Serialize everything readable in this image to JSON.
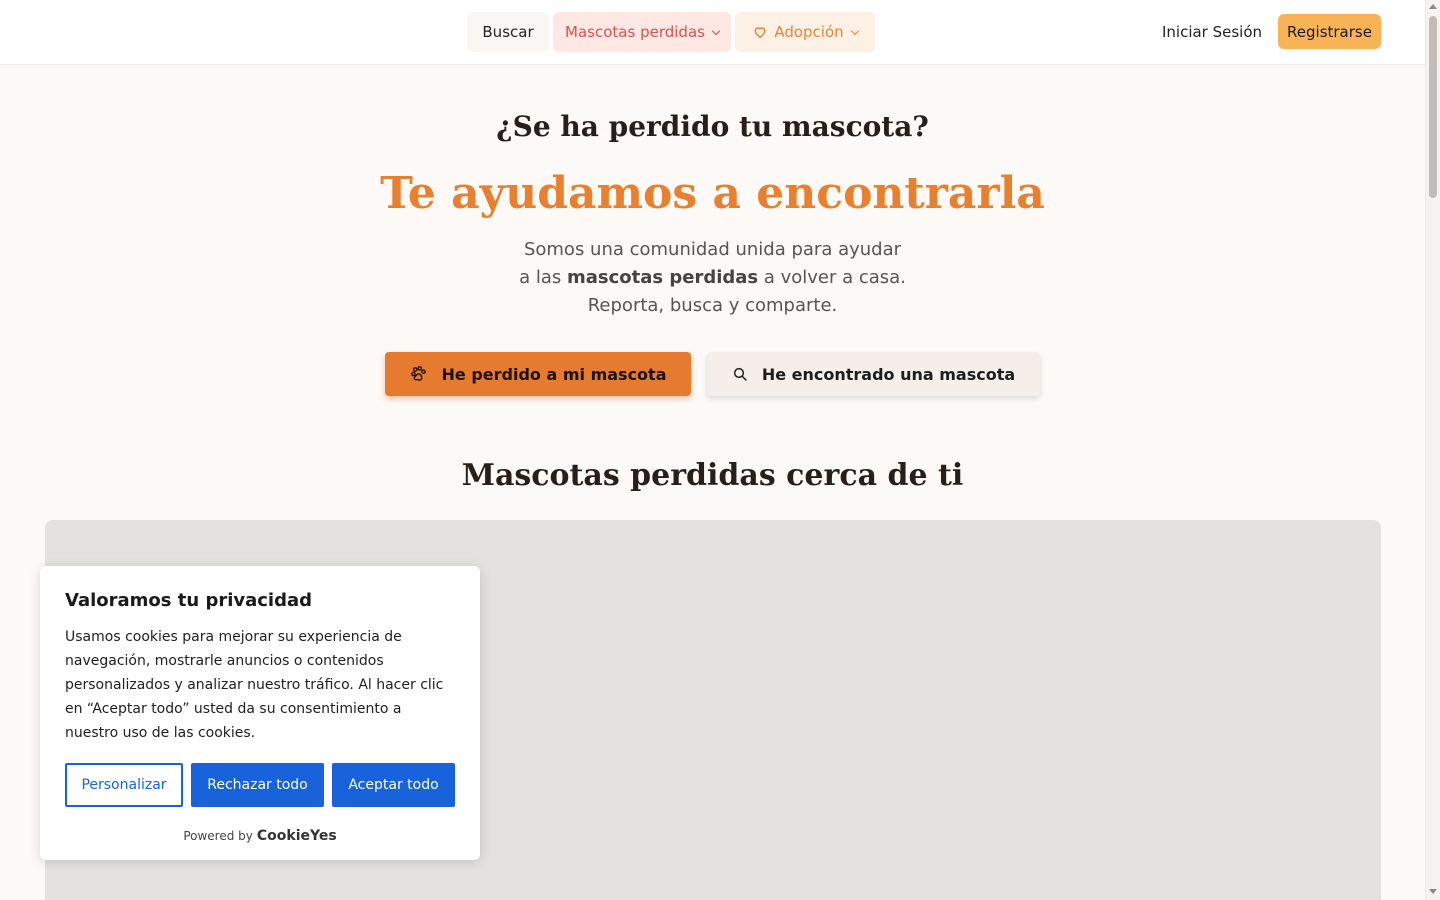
{
  "nav": {
    "search": "Buscar",
    "lost_pets": "Mascotas perdidas",
    "adoption": "Adopción",
    "login": "Iniciar Sesión",
    "register": "Registrarse"
  },
  "hero": {
    "question": "¿Se ha perdido tu mascota?",
    "title": "Te ayudamos a encontrarla",
    "sub_line1": "Somos una comunidad unida para ayudar",
    "sub_line2_pre": "a las ",
    "sub_line2_bold": "mascotas perdidas",
    "sub_line2_post": " a volver a casa.",
    "sub_line3": "Reporta, busca y comparte.",
    "btn_lost": "He perdido a mi mascota",
    "btn_found": "He encontrado una mascota"
  },
  "section": {
    "title": "Mascotas perdidas cerca de ti"
  },
  "cookie": {
    "title": "Valoramos tu privacidad",
    "text": "Usamos cookies para mejorar su experiencia de navegación, mostrarle anuncios o contenidos personalizados y analizar nuestro tráfico. Al hacer clic en “Aceptar todo” usted da su consentimiento a nuestro uso de las cookies.",
    "customize": "Personalizar",
    "reject": "Rechazar todo",
    "accept": "Aceptar todo",
    "powered_by": "Powered by",
    "brand": "CookieYes"
  },
  "colors": {
    "accent_orange": "#e67a2e",
    "register_yellow": "#f8b357",
    "cookie_blue": "#1863dc"
  },
  "icons": {
    "adoption": "heart-icon",
    "lost": "paw-icon",
    "found": "search-icon"
  }
}
